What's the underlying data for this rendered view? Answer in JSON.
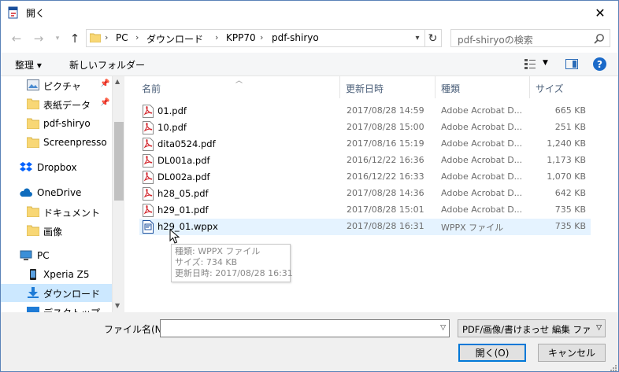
{
  "window": {
    "title": "開く",
    "close": "✕"
  },
  "address": {
    "crumbs": [
      "PC",
      "ダウンロード",
      "KPP70",
      "pdf-shiryo"
    ]
  },
  "search": {
    "placeholder": "pdf-shiryoの検索"
  },
  "commands": {
    "organize": "整理 ▾",
    "new_folder": "新しいフォルダー",
    "help": "?"
  },
  "sidebar": {
    "items": [
      {
        "label": "ピクチャ",
        "icon": "pictures-icon",
        "pinned": true
      },
      {
        "label": "表紙データ",
        "icon": "folder-icon",
        "pinned": true
      },
      {
        "label": "pdf-shiryo",
        "icon": "folder-icon"
      },
      {
        "label": "Screenpresso",
        "icon": "folder-icon"
      },
      {
        "label": "Dropbox",
        "icon": "dropbox-icon"
      },
      {
        "label": "OneDrive",
        "icon": "onedrive-icon"
      },
      {
        "label": "ドキュメント",
        "icon": "folder-icon"
      },
      {
        "label": "画像",
        "icon": "folder-icon"
      },
      {
        "label": "PC",
        "icon": "pc-icon"
      },
      {
        "label": "Xperia Z5",
        "icon": "phone-icon"
      },
      {
        "label": "ダウンロード",
        "icon": "download-icon",
        "selected": true
      },
      {
        "label": "デスクトップ",
        "icon": "desktop-icon"
      }
    ]
  },
  "columns": {
    "name": "名前",
    "date": "更新日時",
    "type": "種類",
    "size": "サイズ"
  },
  "files": [
    {
      "name": "01.pdf",
      "date": "2017/08/28 14:59",
      "type": "Adobe Acrobat D...",
      "size": "665 KB",
      "icon": "pdf-file-icon"
    },
    {
      "name": "10.pdf",
      "date": "2017/08/28 15:00",
      "type": "Adobe Acrobat D...",
      "size": "251 KB",
      "icon": "pdf-file-icon"
    },
    {
      "name": "dita0524.pdf",
      "date": "2017/08/16 15:19",
      "type": "Adobe Acrobat D...",
      "size": "1,240 KB",
      "icon": "pdf-file-icon"
    },
    {
      "name": "DL001a.pdf",
      "date": "2016/12/22 16:36",
      "type": "Adobe Acrobat D...",
      "size": "1,173 KB",
      "icon": "pdf-file-icon"
    },
    {
      "name": "DL002a.pdf",
      "date": "2016/12/22 16:33",
      "type": "Adobe Acrobat D...",
      "size": "1,070 KB",
      "icon": "pdf-file-icon"
    },
    {
      "name": "h28_05.pdf",
      "date": "2017/08/28 14:36",
      "type": "Adobe Acrobat D...",
      "size": "642 KB",
      "icon": "pdf-file-icon"
    },
    {
      "name": "h29_01.pdf",
      "date": "2017/08/28 15:01",
      "type": "Adobe Acrobat D...",
      "size": "735 KB",
      "icon": "pdf-file-icon"
    },
    {
      "name": "h29_01.wppx",
      "date": "2017/08/28 16:31",
      "type": "WPPX ファイル",
      "size": "735 KB",
      "icon": "wppx-file-icon",
      "hover": true
    }
  ],
  "tooltip": {
    "line1": "種類: WPPX ファイル",
    "line2": "サイズ: 734 KB",
    "line3": "更新日時: 2017/08/28 16:31"
  },
  "bottom": {
    "filename_label": "ファイル名(N):",
    "filename_value": "",
    "filter": "PDF/画像/書けまっせ 編集 ファイル",
    "open": "開く(O)",
    "cancel": "キャンセル"
  },
  "colors": {
    "accent": "#0078d7",
    "selected": "#cce8ff",
    "hover": "#e5f3ff",
    "pdf_red": "#d2232a"
  }
}
